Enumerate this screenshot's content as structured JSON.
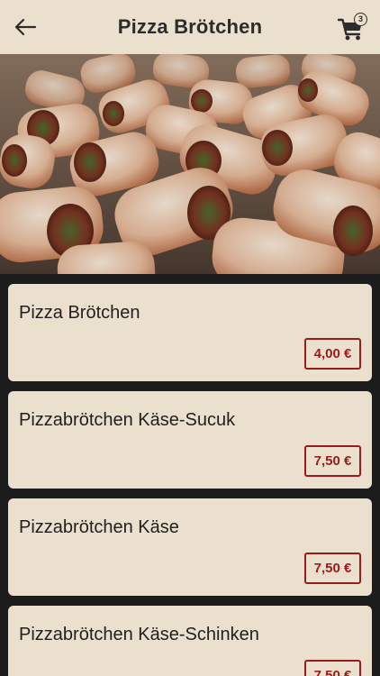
{
  "header": {
    "title": "Pizza Brötchen",
    "back_icon": "arrow-left-icon",
    "cart_icon": "cart-icon",
    "cart_count": "3"
  },
  "hero": {
    "image": "pizza-rolls-photo"
  },
  "products": [
    {
      "name": "Pizza Brötchen",
      "price": "4,00 €"
    },
    {
      "name": "Pizzabrötchen Käse-Sucuk",
      "price": "7,50 €"
    },
    {
      "name": "Pizzabrötchen Käse",
      "price": "7,50 €"
    },
    {
      "name": "Pizzabrötchen Käse-Schinken",
      "price": "7,50 €"
    }
  ],
  "colors": {
    "header_bg": "#ebe0cd",
    "card_bg": "#ebe0cd",
    "price_accent": "#9b1b1b",
    "list_bg": "#1c1c1c"
  }
}
